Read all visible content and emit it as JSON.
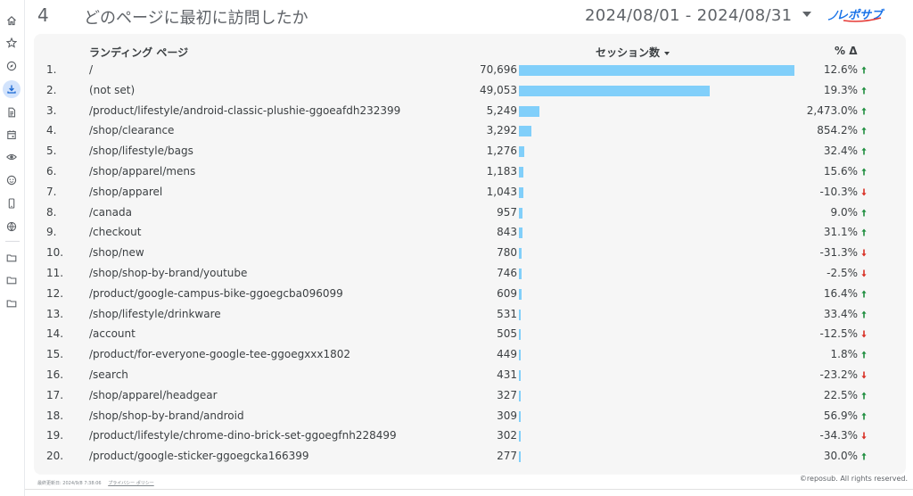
{
  "header": {
    "page_number": "4",
    "title": "どのページに最初に訪問したか",
    "date_range": "2024/08/01 - 2024/08/31",
    "logo_text": "レポサブ"
  },
  "table": {
    "col_page": "ランディング ページ",
    "col_sessions": "セッション数",
    "col_delta": "% Δ",
    "bar_max": 70696,
    "rows": [
      {
        "idx": "1.",
        "page": "/",
        "sessions": "70,696",
        "value": 70696,
        "delta": "12.6%",
        "trend": "up"
      },
      {
        "idx": "2.",
        "page": "(not set)",
        "sessions": "49,053",
        "value": 49053,
        "delta": "19.3%",
        "trend": "up"
      },
      {
        "idx": "3.",
        "page": "/product/lifestyle/android-classic-plushie-ggoeafdh232399",
        "sessions": "5,249",
        "value": 5249,
        "delta": "2,473.0%",
        "trend": "up"
      },
      {
        "idx": "4.",
        "page": "/shop/clearance",
        "sessions": "3,292",
        "value": 3292,
        "delta": "854.2%",
        "trend": "up"
      },
      {
        "idx": "5.",
        "page": "/shop/lifestyle/bags",
        "sessions": "1,276",
        "value": 1276,
        "delta": "32.4%",
        "trend": "up"
      },
      {
        "idx": "6.",
        "page": "/shop/apparel/mens",
        "sessions": "1,183",
        "value": 1183,
        "delta": "15.6%",
        "trend": "up"
      },
      {
        "idx": "7.",
        "page": "/shop/apparel",
        "sessions": "1,043",
        "value": 1043,
        "delta": "-10.3%",
        "trend": "down"
      },
      {
        "idx": "8.",
        "page": "/canada",
        "sessions": "957",
        "value": 957,
        "delta": "9.0%",
        "trend": "up"
      },
      {
        "idx": "9.",
        "page": "/checkout",
        "sessions": "843",
        "value": 843,
        "delta": "31.1%",
        "trend": "up"
      },
      {
        "idx": "10.",
        "page": "/shop/new",
        "sessions": "780",
        "value": 780,
        "delta": "-31.3%",
        "trend": "down"
      },
      {
        "idx": "11.",
        "page": "/shop/shop-by-brand/youtube",
        "sessions": "746",
        "value": 746,
        "delta": "-2.5%",
        "trend": "down"
      },
      {
        "idx": "12.",
        "page": "/product/google-campus-bike-ggoegcba096099",
        "sessions": "609",
        "value": 609,
        "delta": "16.4%",
        "trend": "up"
      },
      {
        "idx": "13.",
        "page": "/shop/lifestyle/drinkware",
        "sessions": "531",
        "value": 531,
        "delta": "33.4%",
        "trend": "up"
      },
      {
        "idx": "14.",
        "page": "/account",
        "sessions": "505",
        "value": 505,
        "delta": "-12.5%",
        "trend": "down"
      },
      {
        "idx": "15.",
        "page": "/product/for-everyone-google-tee-ggoegxxx1802",
        "sessions": "449",
        "value": 449,
        "delta": "1.8%",
        "trend": "up"
      },
      {
        "idx": "16.",
        "page": "/search",
        "sessions": "431",
        "value": 431,
        "delta": "-23.2%",
        "trend": "down"
      },
      {
        "idx": "17.",
        "page": "/shop/apparel/headgear",
        "sessions": "327",
        "value": 327,
        "delta": "22.5%",
        "trend": "up"
      },
      {
        "idx": "18.",
        "page": "/shop/shop-by-brand/android",
        "sessions": "309",
        "value": 309,
        "delta": "56.9%",
        "trend": "up"
      },
      {
        "idx": "19.",
        "page": "/product/lifestyle/chrome-dino-brick-set-ggoegfnh228499",
        "sessions": "302",
        "value": 302,
        "delta": "-34.3%",
        "trend": "down"
      },
      {
        "idx": "20.",
        "page": "/product/google-sticker-ggoegcka166399",
        "sessions": "277",
        "value": 277,
        "delta": "30.0%",
        "trend": "up"
      }
    ]
  },
  "footer": {
    "updated": "最終更新日: 2024/9/8 7:38:06",
    "privacy": "プライバシー ポリシー",
    "copyright": "©reposub. All rights reserved."
  },
  "colors": {
    "bar": "#81cffa",
    "up": "#1e8e3e",
    "down": "#d93025",
    "active_nav": "#d2e3fc"
  },
  "nav_icons": [
    "home-icon",
    "star-icon",
    "compass-icon",
    "download-icon",
    "document-icon",
    "calendar-icon",
    "eye-icon",
    "face-icon",
    "phone-icon",
    "globe-icon",
    "folder-icon",
    "folder-icon",
    "folder-icon"
  ]
}
